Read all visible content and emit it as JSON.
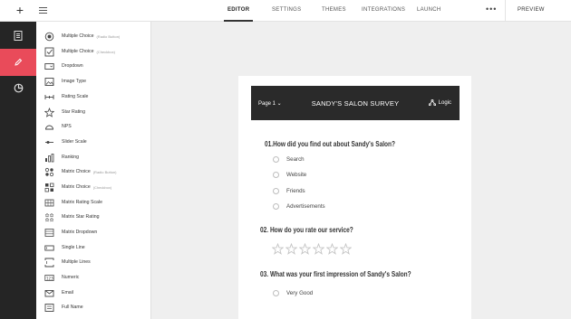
{
  "toolbar": {
    "tabs": [
      {
        "label": "EDITOR",
        "active": true
      },
      {
        "label": "SETTINGS",
        "active": false
      },
      {
        "label": "THEMES",
        "active": false
      },
      {
        "label": "INTEGRATIONS",
        "active": false
      },
      {
        "label": "LAUNCH",
        "active": false
      }
    ],
    "more_label": "•••",
    "preview_label": "PREVIEW",
    "add_icon": "plus-icon",
    "list_icon": "list-icon"
  },
  "rail": {
    "items": [
      {
        "icon": "document-icon",
        "active": false
      },
      {
        "icon": "pencil-icon",
        "active": true
      },
      {
        "icon": "palette-icon",
        "active": false
      }
    ],
    "accent_color": "#e94b5a"
  },
  "question_types": [
    {
      "icon": "radio-button-icon",
      "label": "Multiple Choice",
      "sub": "(Radio Button)"
    },
    {
      "icon": "checkbox-icon",
      "label": "Multiple Choice",
      "sub": "(Checkbox)"
    },
    {
      "icon": "dropdown-icon",
      "label": "Dropdown",
      "sub": ""
    },
    {
      "icon": "image-icon",
      "label": "Image Type",
      "sub": ""
    },
    {
      "icon": "rating-scale-icon",
      "label": "Rating Scale",
      "sub": ""
    },
    {
      "icon": "star-icon",
      "label": "Star Rating",
      "sub": ""
    },
    {
      "icon": "nps-gauge-icon",
      "label": "NPS",
      "sub": ""
    },
    {
      "icon": "slider-icon",
      "label": "Slider Scale",
      "sub": ""
    },
    {
      "icon": "ranking-icon",
      "label": "Ranking",
      "sub": ""
    },
    {
      "icon": "matrix-radio-icon",
      "label": "Matrix Choice",
      "sub": "(Radio Button)"
    },
    {
      "icon": "matrix-checkbox-icon",
      "label": "Matrix Choice",
      "sub": "(Checkbox)"
    },
    {
      "icon": "matrix-rating-icon",
      "label": "Matrix Rating Scale",
      "sub": ""
    },
    {
      "icon": "matrix-star-icon",
      "label": "Matrix Star Rating",
      "sub": ""
    },
    {
      "icon": "matrix-dropdown-icon",
      "label": "Matrix Dropdown",
      "sub": ""
    },
    {
      "icon": "single-line-icon",
      "label": "Single Line",
      "sub": ""
    },
    {
      "icon": "multiple-lines-icon",
      "label": "Multiple Lines",
      "sub": ""
    },
    {
      "icon": "numeric-icon",
      "label": "Numeric",
      "sub": ""
    },
    {
      "icon": "email-icon",
      "label": "Email",
      "sub": ""
    },
    {
      "icon": "full-name-icon",
      "label": "Full Name",
      "sub": ""
    }
  ],
  "survey": {
    "page_label": "Page 1 ⌄",
    "title": "SANDY'S SALON SURVEY",
    "logic_label": "Logic",
    "questions": [
      {
        "text": "01.How did you find out about Sandy's Salon?",
        "options": [
          "Search",
          "Website",
          "Friends",
          "Advertisements"
        ]
      },
      {
        "text": "02. How do you rate our service?",
        "star_count": 6
      },
      {
        "text": "03. What was your first impression of Sandy's Salon?",
        "options": [
          "Very Good"
        ]
      }
    ]
  }
}
